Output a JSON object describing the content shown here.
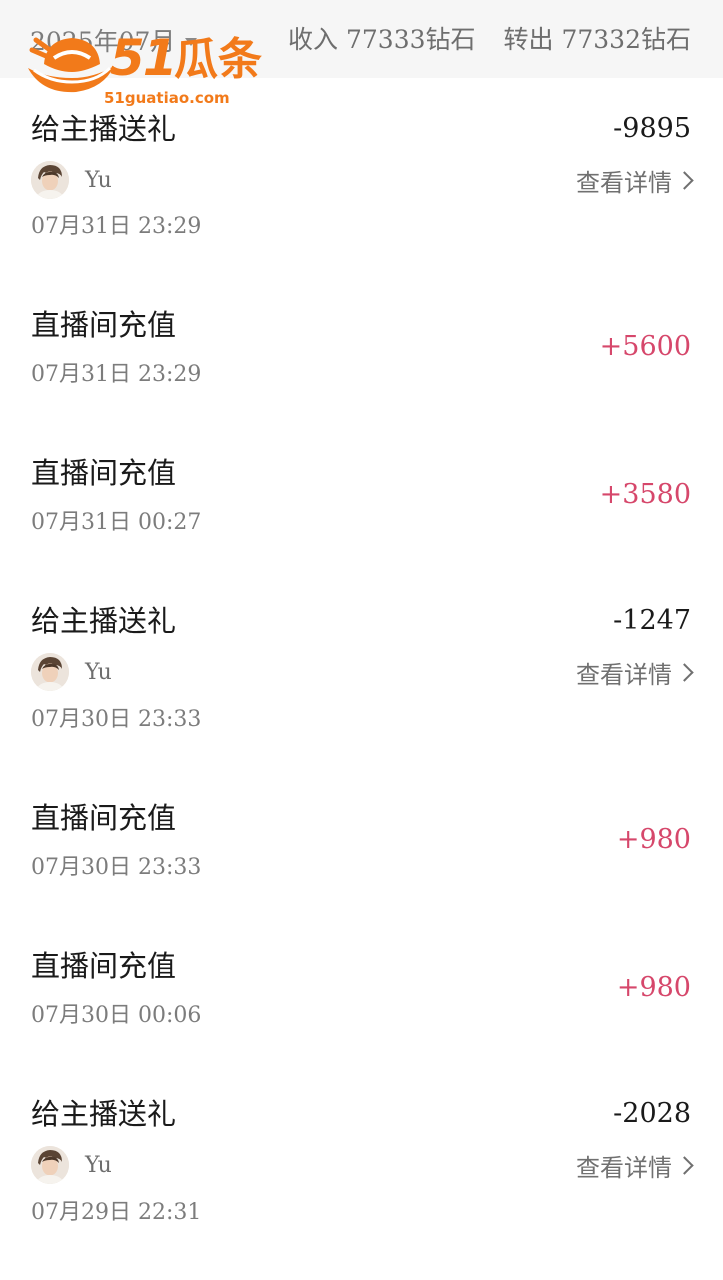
{
  "header": {
    "month": "2025年07月",
    "income": "收入 77333钻石",
    "outgo": "转出 77332钻石"
  },
  "watermark": {
    "brand_number": "51",
    "brand_name": "瓜条",
    "url": "51guatiao.com",
    "color": "#f27a1a"
  },
  "transactions": [
    {
      "title": "给主播送礼",
      "amount": "-9895",
      "user": "Yu",
      "detail": "查看详情",
      "time": "07月31日 23:29"
    },
    {
      "title": "直播间充值",
      "amount": "+5600",
      "time": "07月31日 23:29"
    },
    {
      "title": "直播间充值",
      "amount": "+3580",
      "time": "07月31日 00:27"
    },
    {
      "title": "给主播送礼",
      "amount": "-1247",
      "user": "Yu",
      "detail": "查看详情",
      "time": "07月30日 23:33"
    },
    {
      "title": "直播间充值",
      "amount": "+980",
      "time": "07月30日 23:33"
    },
    {
      "title": "直播间充值",
      "amount": "+980",
      "time": "07月30日 00:06"
    },
    {
      "title": "给主播送礼",
      "amount": "-2028",
      "user": "Yu",
      "detail": "查看详情",
      "time": "07月29日 22:31"
    }
  ],
  "colors": {
    "positive_amount": "#d6476b",
    "negative_amount": "#1a1a1a",
    "secondary_text": "#707070",
    "header_bg": "#f6f6f6"
  },
  "icons": {
    "month_dropdown": "caret-down-icon",
    "detail_link": "chevron-right-icon",
    "user_avatar": "avatar-photo"
  }
}
